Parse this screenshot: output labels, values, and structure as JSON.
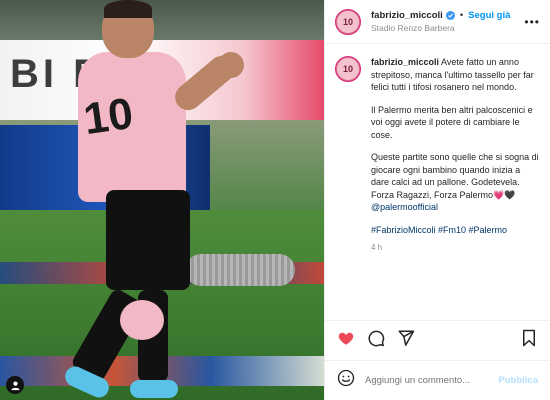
{
  "post": {
    "username": "fabrizio_miccoli",
    "follow_label": "Segui già",
    "location": "Stadio Renzo Barbera",
    "avatar_text": "10",
    "caption": {
      "p1": "Avete fatto un anno strepitoso, manca l'ultimo tassello per far felici tutti i tifosi rosanero nel mondo.",
      "p2": "Il Palermo merita ben altri palcoscenici e voi oggi avete il potere di cambiare le cose.",
      "p3_text": "Queste partite sono quelle che si sogna di giocare ogni bambino quando inizia a dare calci ad un pallone. Godetevela. Forza Ragazzi, Forza Palermo",
      "p3_emoji": "💗🖤",
      "p3_mention": "@palermoofficial",
      "hashtags": "#FabrizioMiccoli #Fm10 #Palermo"
    },
    "time": "4 h"
  },
  "photo": {
    "banner_text": "BI  ETT",
    "shirt_number": "10"
  },
  "comment": {
    "placeholder": "Aggiungi un commento...",
    "publish_label": "Pubblica"
  },
  "icons": {
    "like": "heart-icon",
    "comment": "comment-icon",
    "share": "share-icon",
    "save": "bookmark-icon",
    "emoji": "emoji-icon",
    "more": "more-icon",
    "user_tag": "user-tag-icon",
    "verified": "verified-icon"
  },
  "colors": {
    "like": "#ed4956",
    "follow": "#0095f6",
    "link": "#00376b",
    "publish_disabled": "#b2dffc",
    "verified": "#3897f0"
  }
}
